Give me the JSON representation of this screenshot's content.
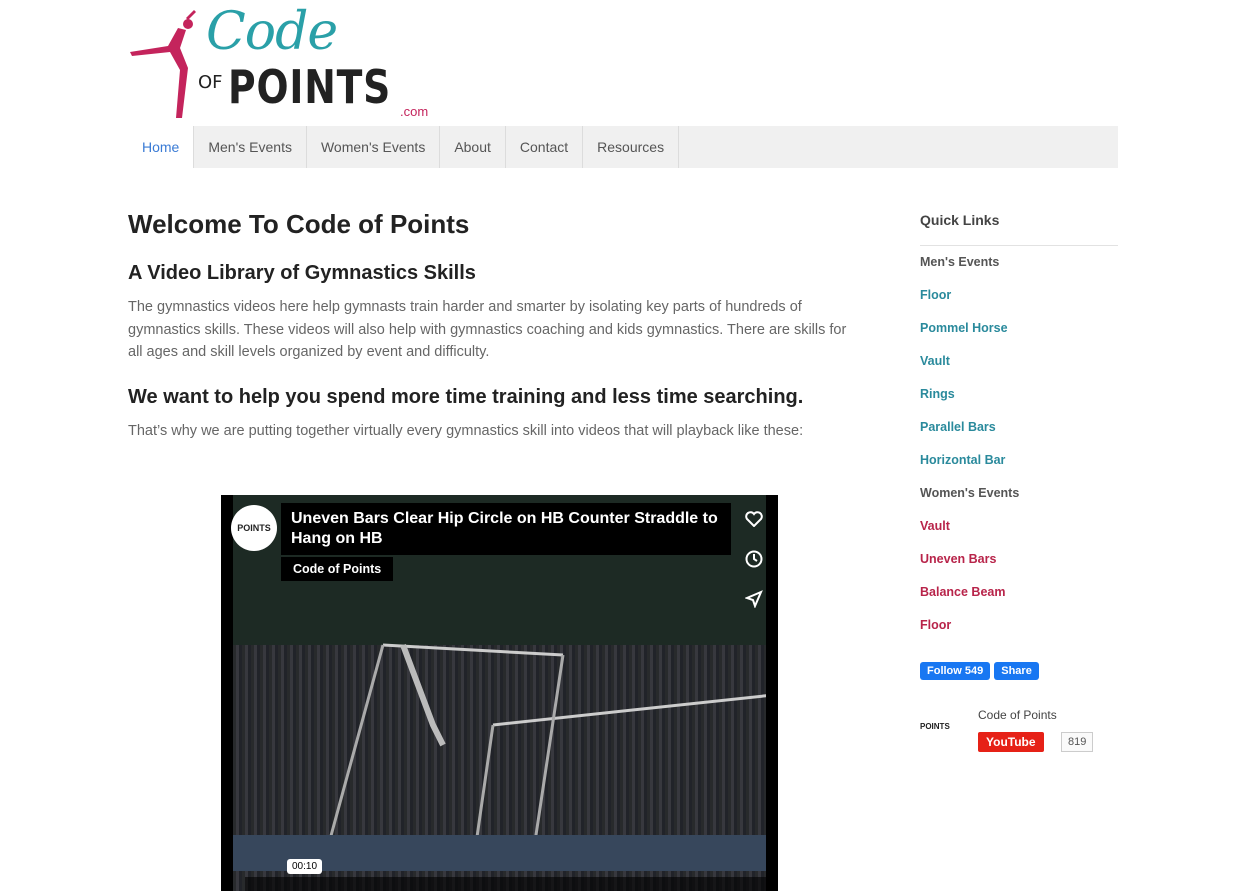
{
  "logo": {
    "code": "Code",
    "of": "OF",
    "points": "POINTS",
    "dotcom": ".com"
  },
  "nav": [
    {
      "label": "Home",
      "active": true
    },
    {
      "label": "Men's Events"
    },
    {
      "label": "Women's Events"
    },
    {
      "label": "About"
    },
    {
      "label": "Contact"
    },
    {
      "label": "Resources"
    }
  ],
  "main": {
    "title": "Welcome To Code of Points",
    "subtitle": "A Video Library of Gymnastics Skills",
    "intro": "The gymnastics videos here help gymnasts train harder and smarter by isolating key parts of hundreds of gymnastics skills. These videos will also help with gymnastics coaching and kids gymnastics. There are skills for all ages and skill levels organized by event and difficulty.",
    "heading2": "We want to help you spend more time training and less time searching.",
    "para2": "That’s why we are putting together virtually every gymnastics skill into videos that will playback like these:"
  },
  "video": {
    "title": "Uneven Bars Clear Hip Circle on HB Counter Straddle to Hang on HB",
    "channel": "Code of Points",
    "time": "00:10",
    "logo_text": "POINTS",
    "icons": [
      "heart-icon",
      "clock-icon",
      "send-icon"
    ]
  },
  "sidebar": {
    "title": "Quick Links",
    "items": [
      {
        "label": "Men's Events",
        "type": "head"
      },
      {
        "label": "Floor",
        "type": "men"
      },
      {
        "label": "Pommel Horse",
        "type": "men"
      },
      {
        "label": "Vault",
        "type": "men"
      },
      {
        "label": "Rings",
        "type": "men"
      },
      {
        "label": "Parallel Bars",
        "type": "men"
      },
      {
        "label": "Horizontal Bar",
        "type": "men"
      },
      {
        "label": "Women's Events",
        "type": "head"
      },
      {
        "label": "Vault",
        "type": "women"
      },
      {
        "label": "Uneven Bars",
        "type": "women"
      },
      {
        "label": "Balance Beam",
        "type": "women"
      },
      {
        "label": "Floor",
        "type": "women"
      }
    ]
  },
  "facebook": {
    "follow": "Follow 549",
    "share": "Share"
  },
  "youtube": {
    "name": "Code of Points",
    "button": "YouTube",
    "count": "819",
    "logo_text": "POINTS"
  },
  "colors": {
    "teal": "#2aa0a8",
    "crimson": "#c4245c",
    "nav_active": "#3a7bd5"
  }
}
